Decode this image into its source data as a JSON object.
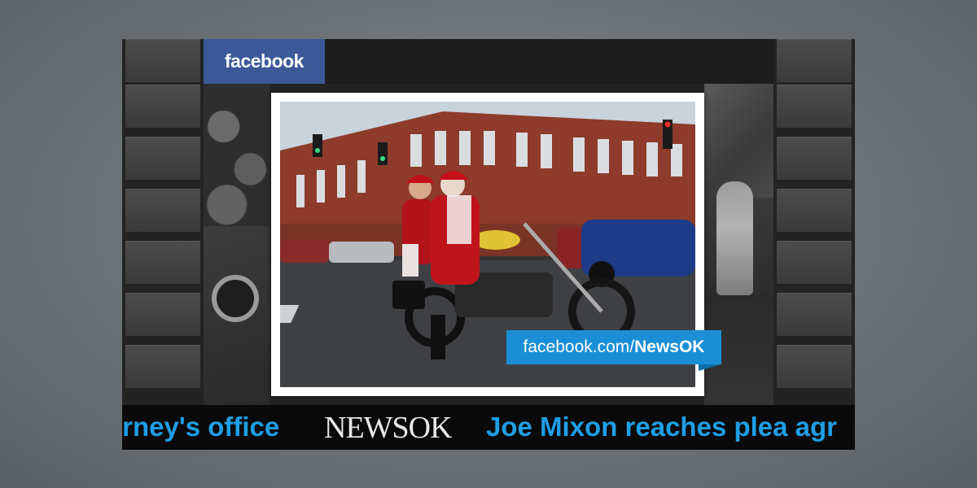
{
  "brand": {
    "facebook_label": "facebook",
    "colors": {
      "facebook": "#3b5998",
      "accent": "#1b8fd6",
      "ticker_text": "#1f9ee6"
    }
  },
  "promo": {
    "url_prefix": "facebook.com/",
    "url_handle": "NewsOK"
  },
  "ticker": {
    "left_text": "orney's office",
    "logo": "NEWSOK",
    "right_text": "Joe Mixon reaches plea agr"
  },
  "photo": {
    "description_icon": "photo-image"
  }
}
